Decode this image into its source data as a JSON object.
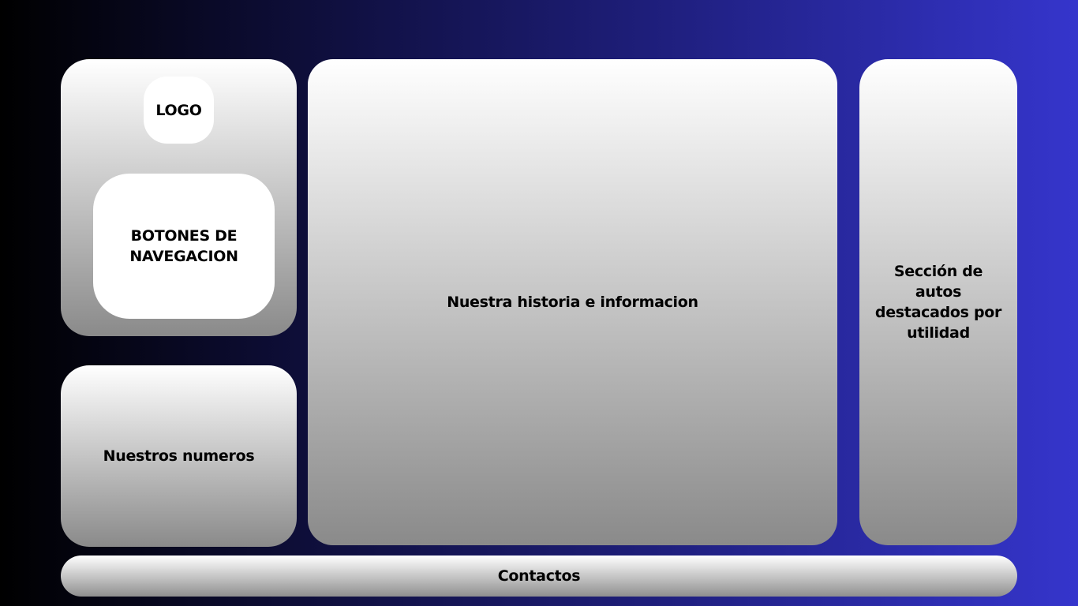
{
  "sidebar": {
    "logo_label": "LOGO",
    "nav_label": "BOTONES DE NAVEGACION"
  },
  "stats": {
    "label": "Nuestros numeros"
  },
  "main": {
    "label": "Nuestra historia e informacion"
  },
  "featured": {
    "label": "Sección de autos destacados por utilidad"
  },
  "footer": {
    "label": "Contactos"
  },
  "colors": {
    "background_left": "#000000",
    "background_right": "#3535cc",
    "panel_top": "#ffffff",
    "panel_bottom": "#8a8a8a"
  }
}
